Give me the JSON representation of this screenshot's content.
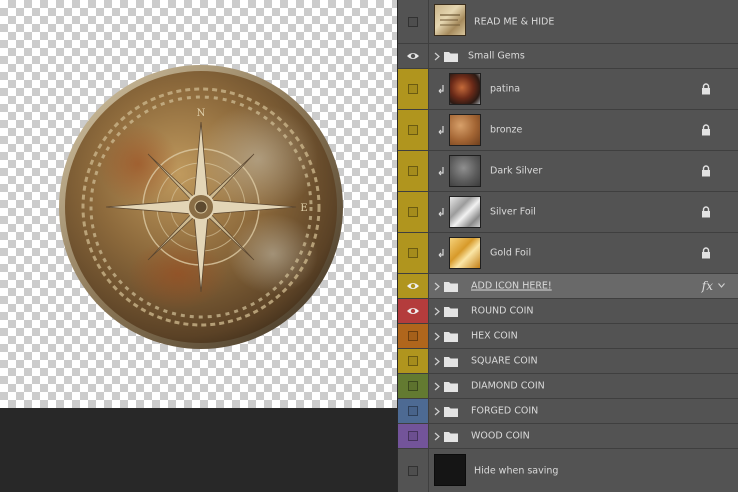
{
  "colors": {
    "panel_bg": "#535353",
    "selected_row": "#696969",
    "canvas_bg": "#282828",
    "tag_yellow": "#b0951e",
    "tag_red": "#b43c3c",
    "tag_orange": "#b0661c",
    "tag_green": "#637a31",
    "tag_blue": "#4d6a93",
    "tag_violet": "#73549a"
  },
  "layers": {
    "read_me": {
      "name": "READ ME & HIDE",
      "visible": false,
      "type": "layer",
      "thumb": "paper-thumbnail"
    },
    "small_gems": {
      "name": "Small Gems",
      "visible": true,
      "type": "group",
      "icon": "folder-icon"
    },
    "patina": {
      "name": "patina",
      "visible": false,
      "type": "clipped-layer",
      "tag": "yellow",
      "locked": true
    },
    "bronze": {
      "name": "bronze",
      "visible": false,
      "type": "clipped-layer",
      "tag": "yellow",
      "locked": true
    },
    "dark_silver": {
      "name": "Dark Silver",
      "visible": false,
      "type": "clipped-layer",
      "tag": "yellow",
      "locked": true
    },
    "silver_foil": {
      "name": "Silver Foil",
      "visible": false,
      "type": "clipped-layer",
      "tag": "yellow",
      "locked": true
    },
    "gold_foil": {
      "name": "Gold Foil",
      "visible": false,
      "type": "clipped-layer",
      "tag": "yellow",
      "locked": true
    },
    "add_icon": {
      "name": "ADD ICON HERE!",
      "visible": true,
      "type": "group",
      "tag": "yellow",
      "fx": "fx",
      "selected": true
    },
    "round_coin": {
      "name": "ROUND COIN",
      "visible": true,
      "type": "group",
      "tag": "red"
    },
    "hex_coin": {
      "name": "HEX COIN",
      "visible": false,
      "type": "group",
      "tag": "orange"
    },
    "square_coin": {
      "name": "SQUARE COIN",
      "visible": false,
      "type": "group",
      "tag": "yellow"
    },
    "diamond_coin": {
      "name": "DIAMOND COIN",
      "visible": false,
      "type": "group",
      "tag": "green"
    },
    "forged_coin": {
      "name": "FORGED COIN",
      "visible": false,
      "type": "group",
      "tag": "blue"
    },
    "wood_coin": {
      "name": "WOOD COIN",
      "visible": false,
      "type": "group",
      "tag": "violet"
    },
    "hide_saving": {
      "name": "Hide when saving",
      "visible": false,
      "type": "layer",
      "thumb": "black-thumbnail"
    }
  }
}
